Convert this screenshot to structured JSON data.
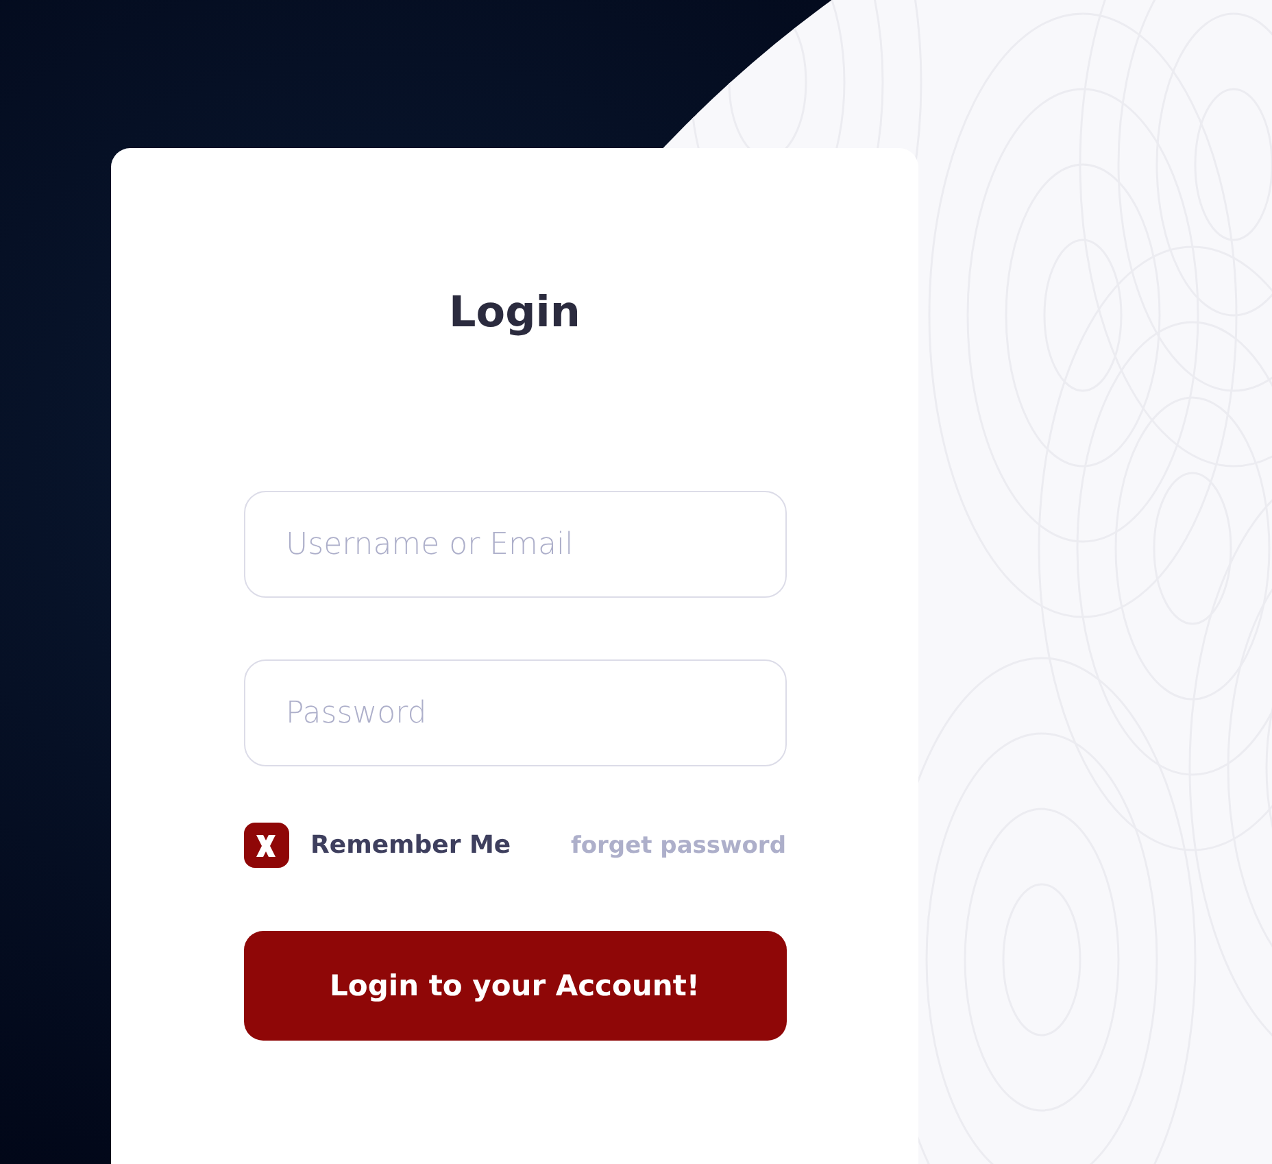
{
  "title": "Login",
  "fields": [
    {
      "placeholder": "Username or Email"
    },
    {
      "placeholder": "Password"
    }
  ],
  "remember": {
    "label": "Remember Me",
    "checked": true
  },
  "forgot_link": "forget password",
  "submit_button": "Login to your Account!"
}
